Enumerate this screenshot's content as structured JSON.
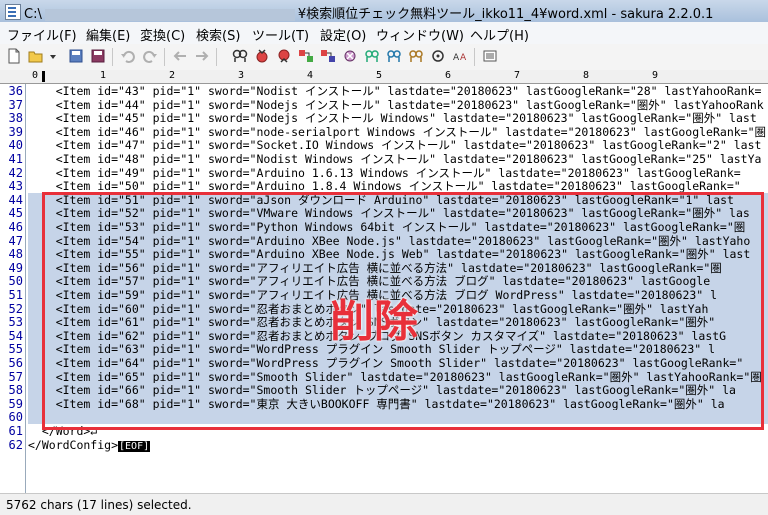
{
  "window": {
    "title_prefix": "C:\\",
    "title_suffix": "¥検索順位チェック無料ツール_ikko11_4¥word.xml - sakura 2.2.0.1"
  },
  "menu": [
    "ファイル(F)",
    "編集(E)",
    "変換(C)",
    "検索(S)",
    "ツール(T)",
    "設定(O)",
    "ウィンドウ(W)",
    "ヘルプ(H)"
  ],
  "ruler": {
    "ticks": [
      "0",
      "1",
      "2",
      "3",
      "4",
      "5",
      "6",
      "7",
      "8",
      "9"
    ]
  },
  "lines": [
    {
      "no": "36",
      "text": "    <Item id=\"43\" pid=\"1\" sword=\"Nodist インストール\" lastdate=\"20180623\" lastGoogleRank=\"28\" lastYahooRank=",
      "sel": false
    },
    {
      "no": "37",
      "text": "    <Item id=\"44\" pid=\"1\" sword=\"Nodejs インストール\" lastdate=\"20180623\" lastGoogleRank=\"圏外\" lastYahooRank",
      "sel": false
    },
    {
      "no": "38",
      "text": "    <Item id=\"45\" pid=\"1\" sword=\"Nodejs インストール Windows\" lastdate=\"20180623\" lastGoogleRank=\"圏外\" last",
      "sel": false
    },
    {
      "no": "39",
      "text": "    <Item id=\"46\" pid=\"1\" sword=\"node-serialport Windows インストール\" lastdate=\"20180623\" lastGoogleRank=\"圏",
      "sel": false
    },
    {
      "no": "40",
      "text": "    <Item id=\"47\" pid=\"1\" sword=\"Socket.IO Windows インストール\" lastdate=\"20180623\" lastGoogleRank=\"2\" last",
      "sel": false
    },
    {
      "no": "41",
      "text": "    <Item id=\"48\" pid=\"1\" sword=\"Nodist Windows インストール\" lastdate=\"20180623\" lastGoogleRank=\"25\" lastYa",
      "sel": false
    },
    {
      "no": "42",
      "text": "    <Item id=\"49\" pid=\"1\" sword=\"Arduino 1.6.13 Windows インストール\" lastdate=\"20180623\" lastGoogleRank=",
      "sel": false
    },
    {
      "no": "43",
      "text": "    <Item id=\"50\" pid=\"1\" sword=\"Arduino 1.8.4 Windows インストール\" lastdate=\"20180623\" lastGoogleRank=\"",
      "sel": false
    },
    {
      "no": "44",
      "text": "    <Item id=\"51\" pid=\"1\" sword=\"aJson ダウンロード Arduino\" lastdate=\"20180623\" lastGoogleRank=\"1\" last",
      "sel": true
    },
    {
      "no": "45",
      "text": "    <Item id=\"52\" pid=\"1\" sword=\"VMware Windows インストール\" lastdate=\"20180623\" lastGoogleRank=\"圏外\" las",
      "sel": true
    },
    {
      "no": "46",
      "text": "    <Item id=\"53\" pid=\"1\" sword=\"Python Windows 64bit インストール\" lastdate=\"20180623\" lastGoogleRank=\"圏",
      "sel": true
    },
    {
      "no": "47",
      "text": "    <Item id=\"54\" pid=\"1\" sword=\"Arduino XBee Node.js\" lastdate=\"20180623\" lastGoogleRank=\"圏外\" lastYaho",
      "sel": true
    },
    {
      "no": "48",
      "text": "    <Item id=\"55\" pid=\"1\" sword=\"Arduino XBee Node.js Web\" lastdate=\"20180623\" lastGoogleRank=\"圏外\" last",
      "sel": true
    },
    {
      "no": "49",
      "text": "    <Item id=\"56\" pid=\"1\" sword=\"アフィリエイト広告 横に並べる方法\" lastdate=\"20180623\" lastGoogleRank=\"圏",
      "sel": true
    },
    {
      "no": "50",
      "text": "    <Item id=\"57\" pid=\"1\" sword=\"アフィリエイト広告 横に並べる方法 ブログ\" lastdate=\"20180623\" lastGoogle",
      "sel": true
    },
    {
      "no": "51",
      "text": "    <Item id=\"59\" pid=\"1\" sword=\"アフィリエイト広告 横に並べる方法 ブログ WordPress\" lastdate=\"20180623\" l",
      "sel": true
    },
    {
      "no": "52",
      "text": "    <Item id=\"60\" pid=\"1\" sword=\"忍者おまとめボタン\" lastdate=\"20180623\" lastGoogleRank=\"圏外\" lastYah",
      "sel": true
    },
    {
      "no": "53",
      "text": "    <Item id=\"61\" pid=\"1\" sword=\"忍者おまとめボタン SNSボタン\" lastdate=\"20180623\" lastGoogleRank=\"圏外\"",
      "sel": true
    },
    {
      "no": "54",
      "text": "    <Item id=\"62\" pid=\"1\" sword=\"忍者おまとめボタン ブログ SNSボタン カスタマイズ\" lastdate=\"20180623\" lastG",
      "sel": true
    },
    {
      "no": "55",
      "text": "    <Item id=\"63\" pid=\"1\" sword=\"WordPress プラグイン Smooth Slider トップページ\" lastdate=\"20180623\" l",
      "sel": true
    },
    {
      "no": "56",
      "text": "    <Item id=\"64\" pid=\"1\" sword=\"WordPress プラグイン Smooth Slider\" lastdate=\"20180623\" lastGoogleRank=\"",
      "sel": true
    },
    {
      "no": "57",
      "text": "    <Item id=\"65\" pid=\"1\" sword=\"Smooth Slider\" lastdate=\"20180623\" lastGoogleRank=\"圏外\" lastYahooRank=\"圏",
      "sel": true
    },
    {
      "no": "58",
      "text": "    <Item id=\"66\" pid=\"1\" sword=\"Smooth Slider トップページ\" lastdate=\"20180623\" lastGoogleRank=\"圏外\" la",
      "sel": true
    },
    {
      "no": "59",
      "text": "    <Item id=\"68\" pid=\"1\" sword=\"東京 大きいBOOKOFF 専門書\" lastdate=\"20180623\" lastGoogleRank=\"圏外\" la",
      "sel": true
    },
    {
      "no": "60",
      "text": "",
      "sel": true
    },
    {
      "no": "61",
      "text": "  </Word>↵",
      "sel": false
    },
    {
      "no": "62",
      "text": "</WordConfig>",
      "sel": false
    }
  ],
  "eof_marker": "[EOF]",
  "annotation": {
    "label": "削除",
    "color": "#e8303a"
  },
  "status": "5762 chars (17 lines) selected."
}
